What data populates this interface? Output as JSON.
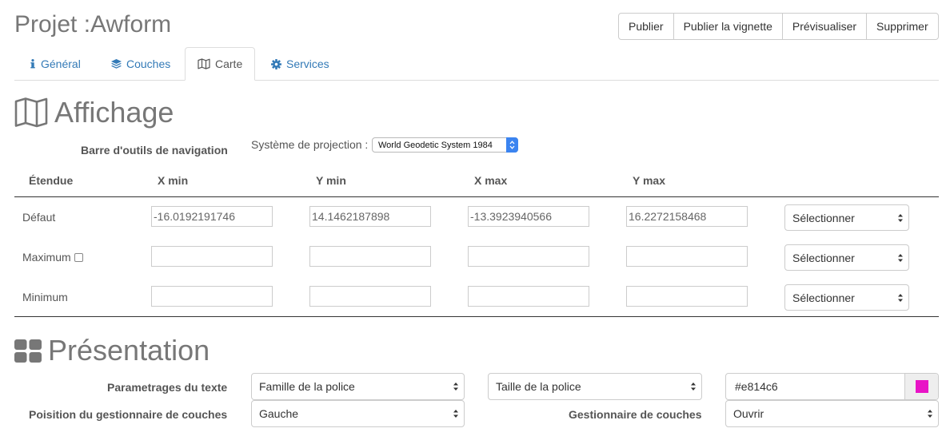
{
  "header": {
    "title": "Projet :Awform",
    "actions": [
      "Publier",
      "Publier la vignette",
      "Prévisualiser",
      "Supprimer"
    ]
  },
  "tabs": [
    {
      "label": "Général",
      "icon": "info-icon"
    },
    {
      "label": "Couches",
      "icon": "layers-icon"
    },
    {
      "label": "Carte",
      "icon": "map-icon",
      "active": true
    },
    {
      "label": "Services",
      "icon": "gear-icon"
    }
  ],
  "affichage": {
    "title": "Affichage",
    "nav_toolbar_label": "Barre d'outils de navigation",
    "projection_label": "Système de projection :",
    "projection_value": "World Geodetic System 1984",
    "columns": [
      "Étendue",
      "X min",
      "Y min",
      "X max",
      "Y max"
    ],
    "rows": [
      {
        "label": "Défaut",
        "xmin": "-16.0192191746",
        "ymin": "14.1462187898",
        "xmax": "-13.3923940566",
        "ymax": "16.2272158468",
        "select": "Sélectionner"
      },
      {
        "label": "Maximum",
        "xmin": "",
        "ymin": "",
        "xmax": "",
        "ymax": "",
        "select": "Sélectionner",
        "has_checkbox": true
      },
      {
        "label": "Minimum",
        "xmin": "",
        "ymin": "",
        "xmax": "",
        "ymax": "",
        "select": "Sélectionner"
      }
    ]
  },
  "presentation": {
    "title": "Présentation",
    "text_settings_label": "Parametrages du texte",
    "font_family": "Famille de la police",
    "font_size": "Taille de la police",
    "color_value": "#e814c6",
    "layer_manager_position_label": "Poisition du gestionnaire de couches",
    "layer_manager_position": "Gauche",
    "layer_manager_label": "Gestionnaire de couches",
    "layer_manager_value": "Ouvrir"
  },
  "colors": {
    "accent": "#337ab7",
    "swatch": "#e814c6",
    "select_blue": "#3b84f0"
  }
}
